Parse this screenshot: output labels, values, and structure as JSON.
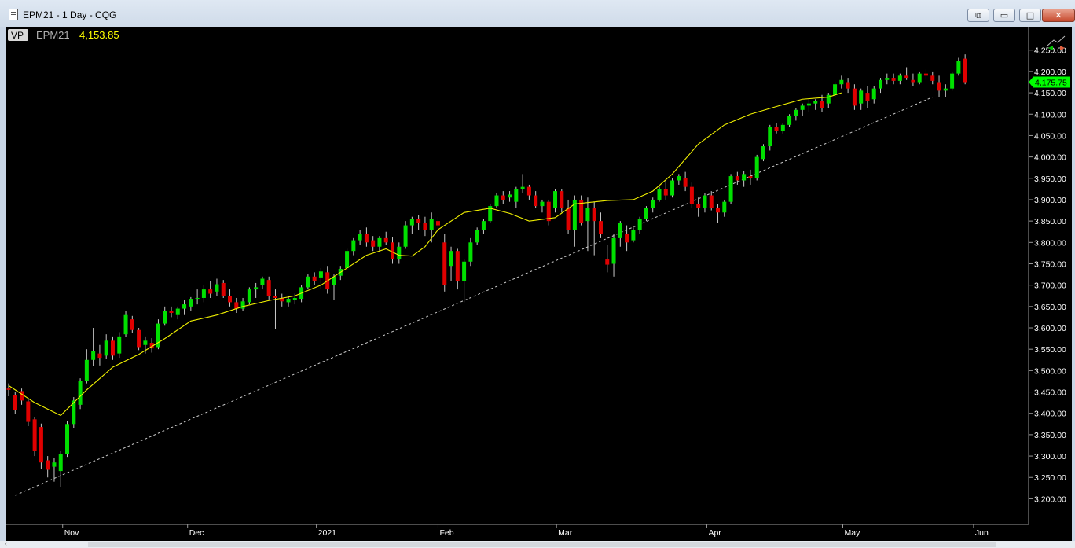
{
  "window": {
    "title": "EPM21 - 1 Day - CQG",
    "buttons": {
      "restore_icon": "restore-window-icon",
      "minimize": "▭",
      "maximize": "□",
      "close": "✕"
    }
  },
  "header": {
    "vp_label": "VP",
    "symbol": "EPM21",
    "last_price": "4,153.85"
  },
  "colors": {
    "up": "#00e000",
    "down": "#e00000",
    "ma": "#f0f000",
    "trendline": "#cccccc",
    "axis_text": "#ffffff",
    "price_tag": "#00ff00"
  },
  "price_tag": "4,175.75",
  "chart_data": {
    "type": "candlestick",
    "ylim": [
      3180,
      4290
    ],
    "y_ticks": [
      "4,250.00",
      "4,200.00",
      "4,150.00",
      "4,100.00",
      "4,050.00",
      "4,000.00",
      "3,950.00",
      "3,900.00",
      "3,850.00",
      "3,800.00",
      "3,750.00",
      "3,700.00",
      "3,650.00",
      "3,600.00",
      "3,550.00",
      "3,500.00",
      "3,450.00",
      "3,400.00",
      "3,350.00",
      "3,300.00",
      "3,250.00",
      "3,200.00"
    ],
    "x_labels": [
      {
        "label": "Nov",
        "bar": 8.3
      },
      {
        "label": "Dec",
        "bar": 27.5
      },
      {
        "label": "2021",
        "bar": 47.3
      },
      {
        "label": "Feb",
        "bar": 66
      },
      {
        "label": "Mar",
        "bar": 84.2
      },
      {
        "label": "Apr",
        "bar": 107.3
      },
      {
        "label": "May",
        "bar": 128.2
      },
      {
        "label": "Jun",
        "bar": 148.3
      }
    ],
    "candles": [
      [
        3458,
        3470,
        3440,
        3455
      ],
      [
        3442,
        3450,
        3398,
        3408
      ],
      [
        3452,
        3458,
        3420,
        3430
      ],
      [
        3428,
        3436,
        3370,
        3380
      ],
      [
        3386,
        3392,
        3300,
        3312
      ],
      [
        3368,
        3376,
        3270,
        3285
      ],
      [
        3290,
        3300,
        3250,
        3268
      ],
      [
        3275,
        3295,
        3240,
        3285
      ],
      [
        3265,
        3312,
        3228,
        3305
      ],
      [
        3305,
        3382,
        3298,
        3375
      ],
      [
        3375,
        3438,
        3365,
        3430
      ],
      [
        3420,
        3482,
        3410,
        3475
      ],
      [
        3475,
        3550,
        3470,
        3525
      ],
      [
        3525,
        3600,
        3510,
        3545
      ],
      [
        3540,
        3560,
        3512,
        3530
      ],
      [
        3535,
        3585,
        3528,
        3570
      ],
      [
        3570,
        3580,
        3525,
        3535
      ],
      [
        3540,
        3590,
        3530,
        3580
      ],
      [
        3585,
        3640,
        3578,
        3630
      ],
      [
        3620,
        3628,
        3588,
        3595
      ],
      [
        3595,
        3600,
        3548,
        3555
      ],
      [
        3560,
        3580,
        3540,
        3570
      ],
      [
        3565,
        3576,
        3542,
        3552
      ],
      [
        3555,
        3620,
        3550,
        3610
      ],
      [
        3610,
        3650,
        3605,
        3640
      ],
      [
        3640,
        3650,
        3625,
        3635
      ],
      [
        3630,
        3650,
        3620,
        3645
      ],
      [
        3645,
        3665,
        3630,
        3655
      ],
      [
        3650,
        3672,
        3640,
        3668
      ],
      [
        3668,
        3690,
        3655,
        3670
      ],
      [
        3670,
        3700,
        3660,
        3690
      ],
      [
        3690,
        3710,
        3670,
        3680
      ],
      [
        3685,
        3715,
        3675,
        3702
      ],
      [
        3705,
        3712,
        3670,
        3675
      ],
      [
        3675,
        3690,
        3650,
        3660
      ],
      [
        3660,
        3670,
        3635,
        3645
      ],
      [
        3645,
        3670,
        3640,
        3662
      ],
      [
        3660,
        3695,
        3655,
        3690
      ],
      [
        3690,
        3705,
        3670,
        3695
      ],
      [
        3700,
        3720,
        3690,
        3715
      ],
      [
        3712,
        3720,
        3665,
        3675
      ],
      [
        3675,
        3690,
        3598,
        3670
      ],
      [
        3670,
        3680,
        3650,
        3662
      ],
      [
        3660,
        3675,
        3650,
        3668
      ],
      [
        3665,
        3680,
        3655,
        3670
      ],
      [
        3668,
        3700,
        3660,
        3695
      ],
      [
        3695,
        3725,
        3690,
        3720
      ],
      [
        3720,
        3730,
        3700,
        3710
      ],
      [
        3718,
        3740,
        3690,
        3732
      ],
      [
        3730,
        3745,
        3680,
        3690
      ],
      [
        3700,
        3725,
        3665,
        3720
      ],
      [
        3722,
        3745,
        3712,
        3738
      ],
      [
        3740,
        3785,
        3735,
        3780
      ],
      [
        3780,
        3810,
        3770,
        3805
      ],
      [
        3805,
        3830,
        3795,
        3820
      ],
      [
        3820,
        3835,
        3790,
        3800
      ],
      [
        3805,
        3815,
        3780,
        3790
      ],
      [
        3790,
        3815,
        3780,
        3810
      ],
      [
        3810,
        3825,
        3795,
        3800
      ],
      [
        3800,
        3812,
        3750,
        3760
      ],
      [
        3760,
        3800,
        3750,
        3790
      ],
      [
        3790,
        3850,
        3785,
        3840
      ],
      [
        3840,
        3860,
        3820,
        3855
      ],
      [
        3855,
        3865,
        3830,
        3845
      ],
      [
        3845,
        3860,
        3815,
        3830
      ],
      [
        3830,
        3870,
        3800,
        3855
      ],
      [
        3850,
        3860,
        3810,
        3840
      ],
      [
        3800,
        3820,
        3685,
        3700
      ],
      [
        3745,
        3790,
        3710,
        3780
      ],
      [
        3780,
        3785,
        3690,
        3710
      ],
      [
        3710,
        3760,
        3660,
        3755
      ],
      [
        3755,
        3810,
        3745,
        3800
      ],
      [
        3800,
        3835,
        3795,
        3830
      ],
      [
        3830,
        3855,
        3820,
        3850
      ],
      [
        3850,
        3890,
        3845,
        3885
      ],
      [
        3885,
        3915,
        3880,
        3910
      ],
      [
        3910,
        3920,
        3890,
        3900
      ],
      [
        3905,
        3920,
        3895,
        3912
      ],
      [
        3895,
        3930,
        3880,
        3925
      ],
      [
        3925,
        3960,
        3915,
        3930
      ],
      [
        3930,
        3935,
        3900,
        3910
      ],
      [
        3910,
        3920,
        3880,
        3885
      ],
      [
        3885,
        3900,
        3870,
        3895
      ],
      [
        3895,
        3900,
        3840,
        3850
      ],
      [
        3880,
        3925,
        3870,
        3920
      ],
      [
        3920,
        3925,
        3870,
        3880
      ],
      [
        3880,
        3900,
        3820,
        3830
      ],
      [
        3830,
        3910,
        3790,
        3900
      ],
      [
        3900,
        3910,
        3840,
        3845
      ],
      [
        3850,
        3905,
        3780,
        3880
      ],
      [
        3880,
        3895,
        3770,
        3850
      ],
      [
        3850,
        3870,
        3810,
        3820
      ],
      [
        3760,
        3795,
        3730,
        3748
      ],
      [
        3750,
        3820,
        3720,
        3810
      ],
      [
        3810,
        3850,
        3790,
        3845
      ],
      [
        3820,
        3840,
        3780,
        3800
      ],
      [
        3805,
        3835,
        3800,
        3830
      ],
      [
        3830,
        3860,
        3820,
        3855
      ],
      [
        3855,
        3885,
        3850,
        3880
      ],
      [
        3880,
        3905,
        3870,
        3900
      ],
      [
        3900,
        3930,
        3895,
        3925
      ],
      [
        3925,
        3945,
        3900,
        3910
      ],
      [
        3910,
        3950,
        3905,
        3945
      ],
      [
        3945,
        3960,
        3935,
        3955
      ],
      [
        3950,
        3965,
        3920,
        3930
      ],
      [
        3930,
        3940,
        3880,
        3890
      ],
      [
        3890,
        3905,
        3860,
        3880
      ],
      [
        3880,
        3915,
        3870,
        3910
      ],
      [
        3910,
        3920,
        3875,
        3880
      ],
      [
        3880,
        3890,
        3845,
        3870
      ],
      [
        3870,
        3900,
        3860,
        3895
      ],
      [
        3895,
        3960,
        3890,
        3955
      ],
      [
        3955,
        3965,
        3935,
        3945
      ],
      [
        3945,
        3968,
        3930,
        3960
      ],
      [
        3955,
        3970,
        3935,
        3950
      ],
      [
        3950,
        4005,
        3945,
        4000
      ],
      [
        3995,
        4030,
        3990,
        4025
      ],
      [
        4025,
        4075,
        4015,
        4070
      ],
      [
        4070,
        4080,
        4055,
        4060
      ],
      [
        4060,
        4080,
        4055,
        4075
      ],
      [
        4075,
        4100,
        4070,
        4095
      ],
      [
        4095,
        4115,
        4085,
        4110
      ],
      [
        4110,
        4125,
        4095,
        4120
      ],
      [
        4120,
        4135,
        4105,
        4125
      ],
      [
        4125,
        4135,
        4110,
        4130
      ],
      [
        4130,
        4145,
        4105,
        4115
      ],
      [
        4125,
        4150,
        4115,
        4145
      ],
      [
        4145,
        4175,
        4140,
        4170
      ],
      [
        4170,
        4190,
        4160,
        4180
      ],
      [
        4175,
        4185,
        4150,
        4160
      ],
      [
        4160,
        4170,
        4110,
        4120
      ],
      [
        4125,
        4160,
        4110,
        4155
      ],
      [
        4150,
        4165,
        4115,
        4130
      ],
      [
        4135,
        4165,
        4125,
        4160
      ],
      [
        4160,
        4185,
        4150,
        4180
      ],
      [
        4180,
        4195,
        4170,
        4185
      ],
      [
        4185,
        4195,
        4170,
        4178
      ],
      [
        4178,
        4195,
        4170,
        4190
      ],
      [
        4190,
        4210,
        4180,
        4185
      ],
      [
        4180,
        4195,
        4165,
        4175
      ],
      [
        4175,
        4200,
        4170,
        4195
      ],
      [
        4195,
        4205,
        4180,
        4190
      ],
      [
        4190,
        4200,
        4170,
        4178
      ],
      [
        4175,
        4190,
        4140,
        4155
      ],
      [
        4155,
        4170,
        4140,
        4160
      ],
      [
        4160,
        4200,
        4155,
        4195
      ],
      [
        4195,
        4232,
        4190,
        4225
      ],
      [
        4230,
        4240,
        4170,
        4175
      ]
    ],
    "moving_average": [
      [
        0,
        3465
      ],
      [
        4,
        3425
      ],
      [
        8,
        3395
      ],
      [
        12,
        3455
      ],
      [
        16,
        3508
      ],
      [
        20,
        3538
      ],
      [
        24,
        3575
      ],
      [
        28,
        3616
      ],
      [
        32,
        3630
      ],
      [
        36,
        3650
      ],
      [
        40,
        3664
      ],
      [
        44,
        3675
      ],
      [
        48,
        3700
      ],
      [
        52,
        3740
      ],
      [
        55,
        3770
      ],
      [
        58,
        3785
      ],
      [
        60,
        3770
      ],
      [
        62,
        3768
      ],
      [
        64,
        3790
      ],
      [
        66,
        3830
      ],
      [
        70,
        3870
      ],
      [
        74,
        3880
      ],
      [
        77,
        3868
      ],
      [
        80,
        3850
      ],
      [
        84,
        3858
      ],
      [
        87,
        3890
      ],
      [
        92,
        3898
      ],
      [
        96,
        3900
      ],
      [
        99,
        3920
      ],
      [
        102,
        3960
      ],
      [
        106,
        4030
      ],
      [
        110,
        4075
      ],
      [
        114,
        4100
      ],
      [
        118,
        4118
      ],
      [
        122,
        4135
      ],
      [
        126,
        4140
      ],
      [
        128,
        4150
      ]
    ],
    "trendline": {
      "from": [
        1,
        3208
      ],
      "to": [
        142,
        4140
      ]
    }
  }
}
